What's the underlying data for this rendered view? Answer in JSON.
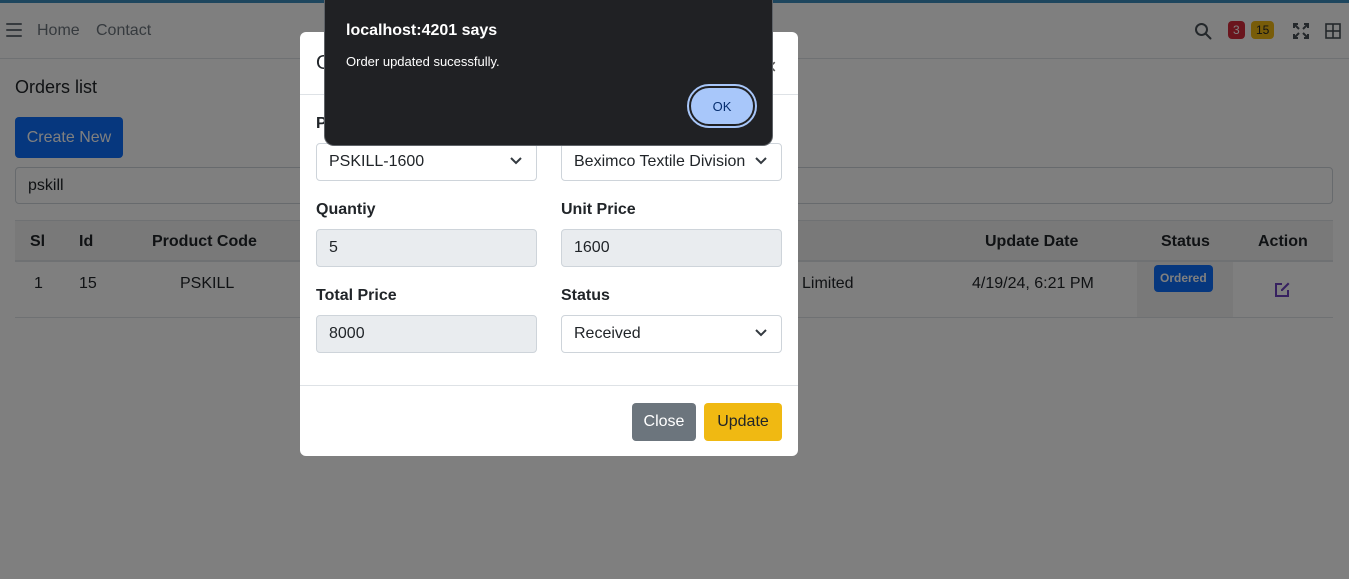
{
  "nav": {
    "home": "Home",
    "contact": "Contact",
    "badge_red": "3",
    "badge_yellow": "15"
  },
  "page": {
    "title": "Orders list",
    "create_label": "Create New",
    "search_value": "pskill"
  },
  "table": {
    "headers": {
      "sl": "Sl",
      "id": "Id",
      "product_code": "Product Code",
      "update_date": "Update Date",
      "status": "Status",
      "action": "Action"
    },
    "rows": [
      {
        "sl": "1",
        "id": "15",
        "product_code": "PSKILL",
        "supplier_partial": "Limited",
        "update_date": "4/19/24, 6:21 PM",
        "status": "Ordered"
      }
    ]
  },
  "modal": {
    "title_partial": "O",
    "close_x": "×",
    "product_label_partial": "P",
    "product_value": "PSKILL-1600",
    "supplier_value": "Beximco Textile Division",
    "quantity_label": "Quantiy",
    "quantity_value": "5",
    "unit_price_label": "Unit Price",
    "unit_price_value": "1600",
    "total_price_label": "Total Price",
    "total_price_value": "8000",
    "status_label": "Status",
    "status_value": "Received",
    "close_label": "Close",
    "update_label": "Update"
  },
  "alert": {
    "title": "localhost:4201 says",
    "message": "Order updated sucessfully.",
    "ok_label": "OK"
  },
  "colors": {
    "primary": "#0d6efd",
    "warning": "#f0b912",
    "secondary": "#6c757d",
    "danger": "#d52b3b"
  }
}
